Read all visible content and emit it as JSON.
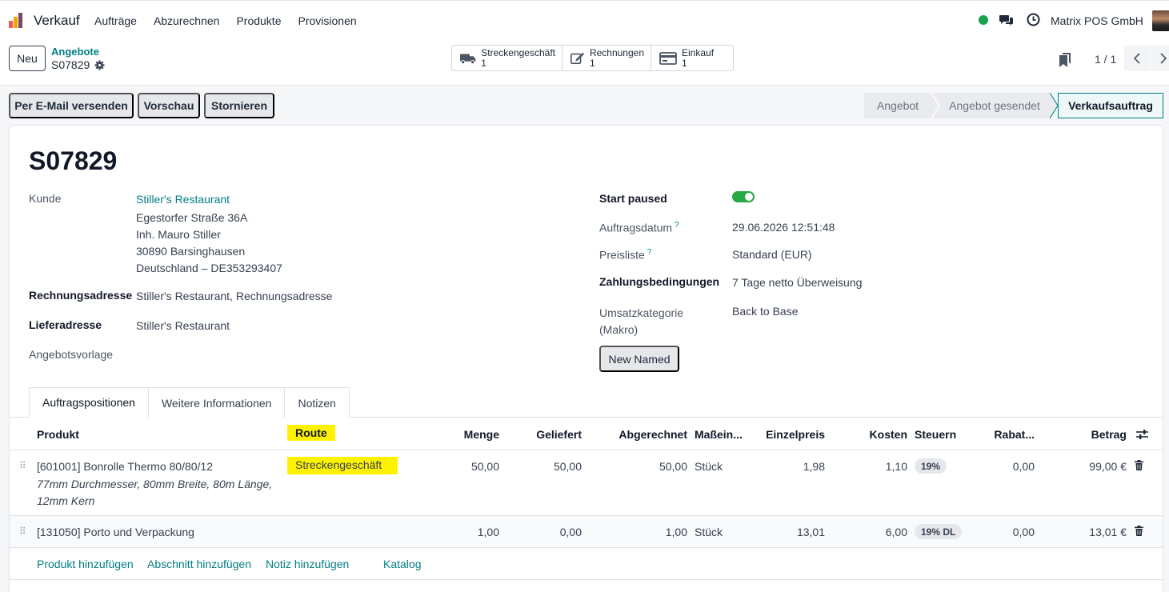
{
  "nav": {
    "app": "Verkauf",
    "items": [
      "Aufträge",
      "Abzurechnen",
      "Produkte",
      "Provisionen"
    ],
    "company": "Matrix POS GmbH"
  },
  "control": {
    "new_label": "Neu",
    "breadcrumb_parent": "Angebote",
    "breadcrumb_current": "S07829",
    "smart": [
      {
        "label": "Streckengeschäft",
        "count": "1",
        "icon": "truck-icon"
      },
      {
        "label": "Rechnungen",
        "count": "1",
        "icon": "edit-icon"
      },
      {
        "label": "Einkauf",
        "count": "1",
        "icon": "credit-card-icon"
      }
    ],
    "pager": "1 / 1"
  },
  "actions": {
    "email": "Per E-Mail versenden",
    "preview": "Vorschau",
    "cancel": "Stornieren"
  },
  "stages": [
    "Angebot",
    "Angebot gesendet",
    "Verkaufsauftrag"
  ],
  "active_stage": "Verkaufsauftrag",
  "form": {
    "title": "S07829",
    "customer_label": "Kunde",
    "customer_name": "Stiller's Restaurant",
    "customer_addr": [
      "Egestorfer Straße 36A",
      "Inh. Mauro Stiller",
      "30890 Barsinghausen",
      "Deutschland – DE353293407"
    ],
    "invoice_label": "Rechnungsadresse",
    "invoice_value": "Stiller's Restaurant, Rechnungsadresse",
    "delivery_label": "Lieferadresse",
    "delivery_value": "Stiller's Restaurant",
    "template_label": "Angebotsvorlage",
    "start_paused_label": "Start paused",
    "start_paused": true,
    "order_date_label": "Auftragsdatum",
    "order_date": "29.06.2026 12:51:48",
    "pricelist_label": "Preisliste",
    "pricelist": "Standard (EUR)",
    "payment_label": "Zahlungsbedingungen",
    "payment": "7 Tage netto Überweisung",
    "sales_cat_label": "Umsatzkategorie (Makro)",
    "sales_cat_line1": "Umsatzkategorie",
    "sales_cat_line2": "(Makro)",
    "sales_cat": "Back to Base",
    "help_mark": "?",
    "new_named": "New Named"
  },
  "tabs": [
    "Auftragspositionen",
    "Weitere Informationen",
    "Notizen"
  ],
  "table": {
    "headers": {
      "product": "Produkt",
      "route": "Route",
      "qty": "Menge",
      "delivered": "Geliefert",
      "invoiced": "Abgerechnet",
      "uom": "Maßein...",
      "price": "Einzelpreis",
      "cost": "Kosten",
      "taxes": "Steuern",
      "discount": "Rabat...",
      "amount": "Betrag"
    },
    "rows": [
      {
        "product": "[601001] Bonrolle Thermo 80/80/12",
        "desc1": "77mm Durchmesser, 80mm Breite, 80m Länge,",
        "desc2": "12mm Kern",
        "route": "Streckengeschäft",
        "qty": "50,00",
        "delivered": "50,00",
        "invoiced": "50,00",
        "uom": "Stück",
        "price": "1,98",
        "cost": "1,10",
        "tax": "19%",
        "discount": "0,00",
        "amount": "99,00 €"
      },
      {
        "product": "[131050] Porto und Verpackung",
        "route": "",
        "qty": "1,00",
        "delivered": "0,00",
        "invoiced": "1,00",
        "uom": "Stück",
        "price": "13,01",
        "cost": "6,00",
        "tax": "19% DL",
        "discount": "0,00",
        "amount": "13,01 €"
      }
    ],
    "add_links": [
      "Produkt hinzufügen",
      "Abschnitt hinzufügen",
      "Notiz hinzufügen",
      "Katalog"
    ]
  },
  "colors": {
    "accent": "#017e84",
    "highlight": "#fff200",
    "online": "#16a34a"
  }
}
